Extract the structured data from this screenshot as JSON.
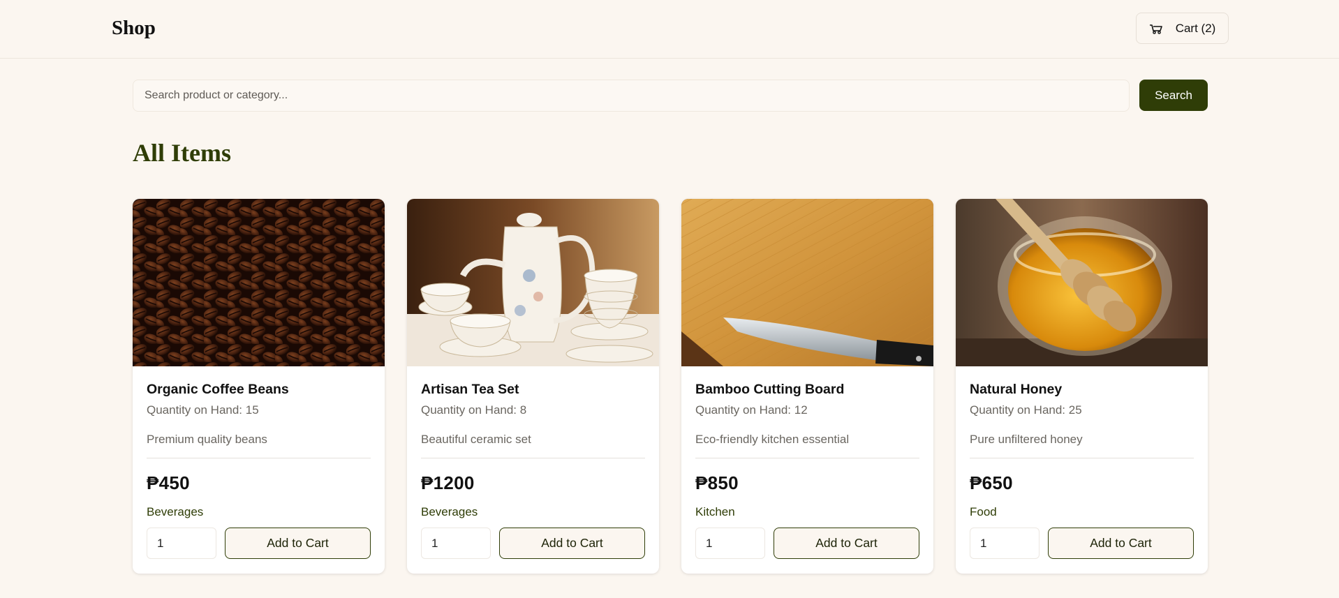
{
  "header": {
    "logo": "Shop",
    "cart_label": "Cart (2)",
    "cart_icon": "cart-icon"
  },
  "search": {
    "placeholder": "Search product or category...",
    "button_label": "Search"
  },
  "section_title": "All Items",
  "colors": {
    "accent": "#2f3d07",
    "background": "#fbf6f0"
  },
  "products": [
    {
      "name": "Organic Coffee Beans",
      "quantity_label": "Quantity on Hand: 15",
      "description": "Premium quality beans",
      "price": "₱450",
      "category": "Beverages",
      "qty_value": "1",
      "add_label": "Add to Cart"
    },
    {
      "name": "Artisan Tea Set",
      "quantity_label": "Quantity on Hand: 8",
      "description": "Beautiful ceramic set",
      "price": "₱1200",
      "category": "Beverages",
      "qty_value": "1",
      "add_label": "Add to Cart"
    },
    {
      "name": "Bamboo Cutting Board",
      "quantity_label": "Quantity on Hand: 12",
      "description": "Eco-friendly kitchen essential",
      "price": "₱850",
      "category": "Kitchen",
      "qty_value": "1",
      "add_label": "Add to Cart"
    },
    {
      "name": "Natural Honey",
      "quantity_label": "Quantity on Hand: 25",
      "description": "Pure unfiltered honey",
      "price": "₱650",
      "category": "Food",
      "qty_value": "1",
      "add_label": "Add to Cart"
    }
  ]
}
